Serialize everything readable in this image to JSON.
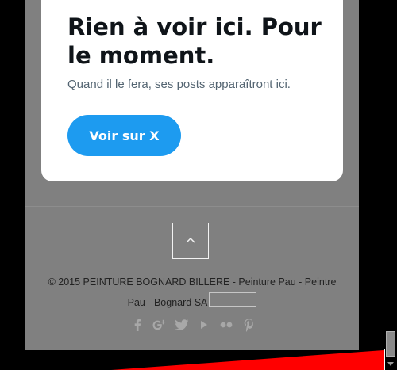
{
  "embed": {
    "title": "Rien à voir ici. Pour le moment.",
    "subtitle": "Quand il le fera, ses posts apparaîtront ici.",
    "button_label": "Voir sur X"
  },
  "footer": {
    "copyright": "© 2015 PEINTURE BOGNARD BILLERE - Peinture Pau - Peintre Pau - Bognard SA",
    "social_icons": [
      "facebook-icon",
      "google-plus-icon",
      "twitter-icon",
      "youtube-icon",
      "flickr-icon",
      "pinterest-icon"
    ]
  },
  "colors": {
    "accent": "#1d9bf0",
    "page_bg": "#808080",
    "red_overlay": "#ff0000"
  }
}
